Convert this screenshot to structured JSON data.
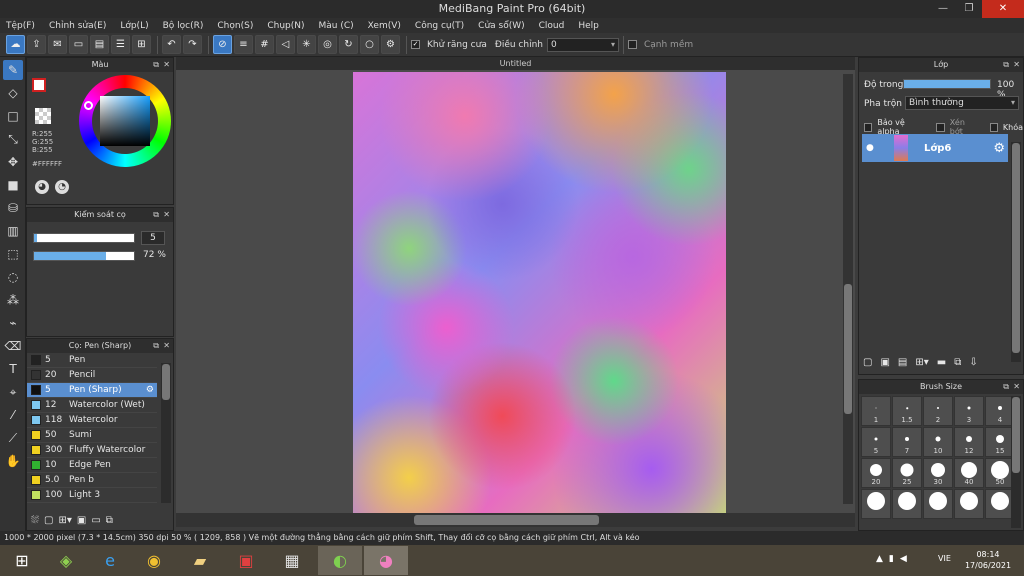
{
  "window": {
    "title": "MediBang Paint Pro (64bit)",
    "minimize": "—",
    "maximize": "❐",
    "close": "✕"
  },
  "menu": [
    "Tệp(F)",
    "Chỉnh sửa(E)",
    "Lớp(L)",
    "Bộ lọc(R)",
    "Chọn(S)",
    "Chụp(N)",
    "Màu (C)",
    "Xem(V)",
    "Công cụ(T)",
    "Cửa sổ(W)",
    "Cloud",
    "Help"
  ],
  "toolbar": {
    "antialias_label": "Khử răng cưa",
    "correction_label": "Điều chỉnh",
    "correction_value": "0",
    "smooth_label": "Cạnh mềm"
  },
  "document": {
    "tab": "Untitled"
  },
  "color_panel": {
    "title": "Màu",
    "r": "R:255",
    "g": "G:255",
    "b": "B:255",
    "hex": "#FFFFFF"
  },
  "brush_control": {
    "title": "Kiểm soát cọ",
    "size": "5",
    "opacity": "72 %",
    "opacity_value": 0.72,
    "size_fill": 0.03
  },
  "brush_list": {
    "title": "Cọ: Pen (Sharp)",
    "items": [
      {
        "num": "5",
        "name": "Pen",
        "color": "#222222"
      },
      {
        "num": "20",
        "name": "Pencil",
        "color": "#333333"
      },
      {
        "num": "5",
        "name": "Pen (Sharp)",
        "color": "#111111"
      },
      {
        "num": "12",
        "name": "Watercolor (Wet)",
        "color": "#7ec8f0"
      },
      {
        "num": "118",
        "name": "Watercolor",
        "color": "#7ec8f0"
      },
      {
        "num": "50",
        "name": "Sumi",
        "color": "#f0d020"
      },
      {
        "num": "300",
        "name": "Fluffy Watercolor",
        "color": "#f0d020"
      },
      {
        "num": "10",
        "name": "Edge Pen",
        "color": "#30b030"
      },
      {
        "num": "5.0",
        "name": "Pen b",
        "color": "#f0d020"
      },
      {
        "num": "100",
        "name": "Light 3",
        "color": "#c0e060"
      }
    ]
  },
  "layer_panel": {
    "title": "Lớp",
    "opacity_label": "Độ trong",
    "opacity_value": "100 %",
    "opacity_fill": 1.0,
    "blend_label": "Pha trộn",
    "blend_value": "Bình thường",
    "protect_alpha": "Bảo vệ alpha",
    "clipping": "Xén bớt",
    "lock": "Khóa",
    "layer_name": "Lớp6"
  },
  "brush_size": {
    "title": "Brush Size",
    "sizes": [
      "1",
      "1.5",
      "2",
      "3",
      "4",
      "5",
      "7",
      "10",
      "12",
      "15",
      "20",
      "25",
      "30",
      "40",
      "50",
      "",
      "",
      "",
      "",
      ""
    ]
  },
  "status": {
    "text": "1000 * 2000 pixel   (7.3 * 14.5cm)   350 dpi   50 %   ( 1209, 858 )   Vẽ một đường thẳng bằng cách giữ phím Shift, Thay đổi cỡ cọ bằng cách giữ phím Ctrl, Alt và kéo"
  },
  "taskbar": {
    "lang": "VIE",
    "time": "08:14",
    "date": "17/06/2021"
  }
}
